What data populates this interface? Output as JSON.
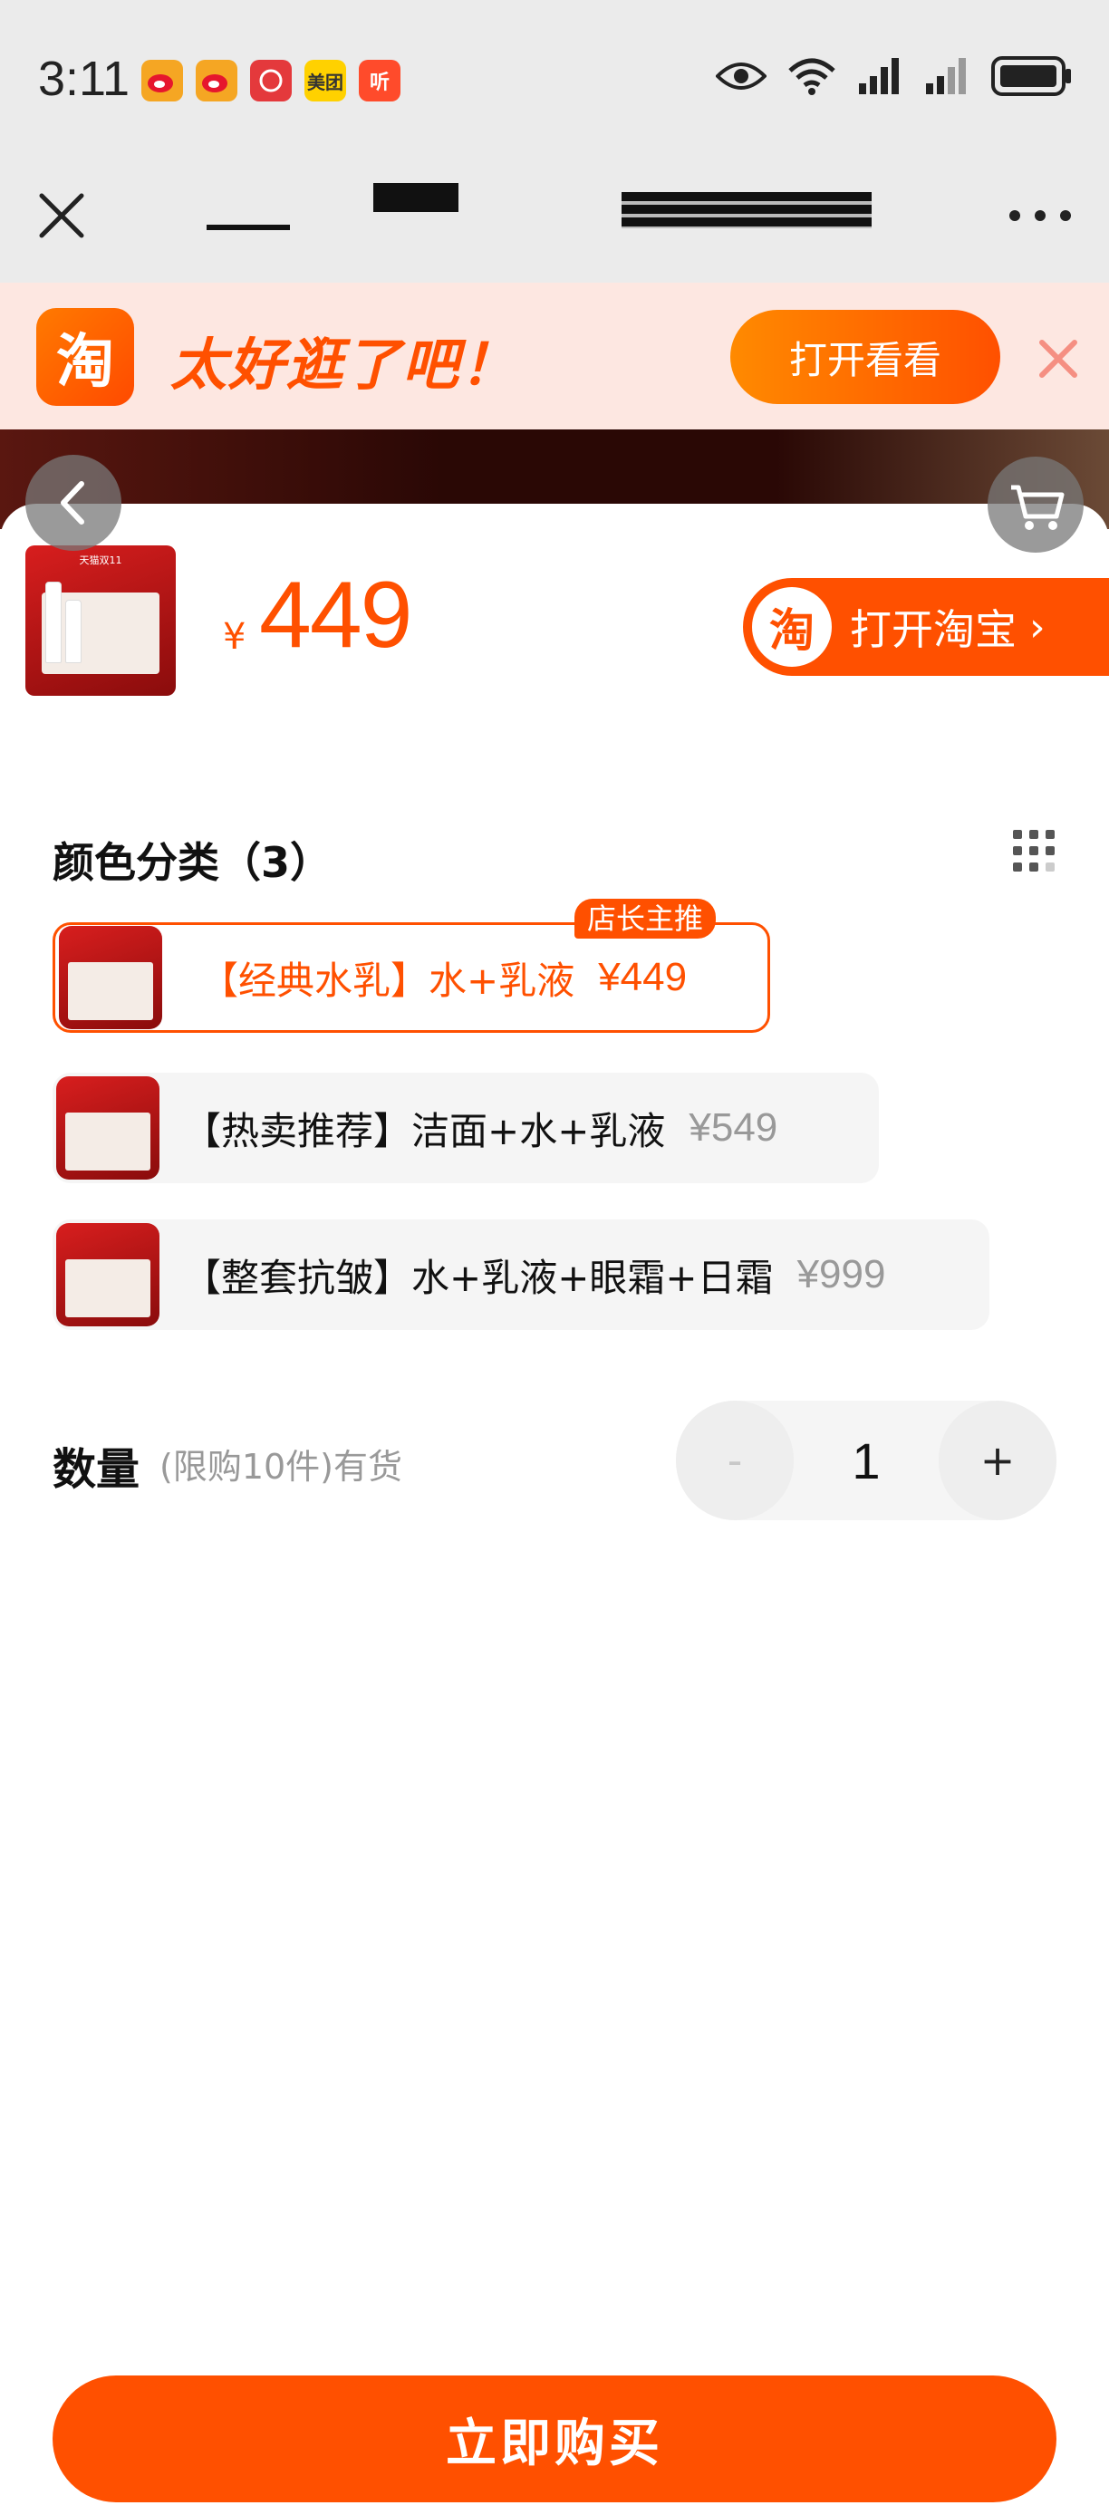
{
  "status_bar": {
    "time": "3:11",
    "notifications": [
      {
        "name": "weibo-icon",
        "label": "",
        "color": "#f5a623"
      },
      {
        "name": "weibo-icon",
        "label": "",
        "color": "#f5a623"
      },
      {
        "name": "app-icon",
        "label": "",
        "color": "#e4393c"
      },
      {
        "name": "meituan-icon",
        "label": "美团",
        "color": "#ffd100"
      },
      {
        "name": "ting-icon",
        "label": "听",
        "color": "#ff4b2b"
      }
    ]
  },
  "browser": {
    "close_icon": "close-icon",
    "more_icon": "more-icon"
  },
  "taobao_banner": {
    "logo_text": "淘",
    "slogan": "太好逛了吧！",
    "open_button": "打开看看"
  },
  "product": {
    "currency": "¥",
    "price": "449",
    "thumb_caption": "天猫双11",
    "open_taobao_logo": "淘",
    "open_taobao_label": "打开淘宝",
    "open_taobao_chevron": "›"
  },
  "variants_section": {
    "title": "颜色分类（3）",
    "recommend_tag": "店长主推",
    "items": [
      {
        "name": "【经典水乳】水+乳液",
        "price": "¥449",
        "selected": true
      },
      {
        "name": "【热卖推荐】洁面+水+乳液",
        "price": "¥549",
        "selected": false
      },
      {
        "name": "【整套抗皱】水+乳液+眼霜+日霜",
        "price": "¥999",
        "selected": false
      }
    ]
  },
  "quantity": {
    "label": "数量",
    "note": "(限购10件)有货",
    "minus": "-",
    "value": "1",
    "plus": "+"
  },
  "buy_button": "立即购买",
  "colors": {
    "accent": "#ff5000",
    "banner_bg": "#fde7e1",
    "muted_text": "#999999"
  }
}
